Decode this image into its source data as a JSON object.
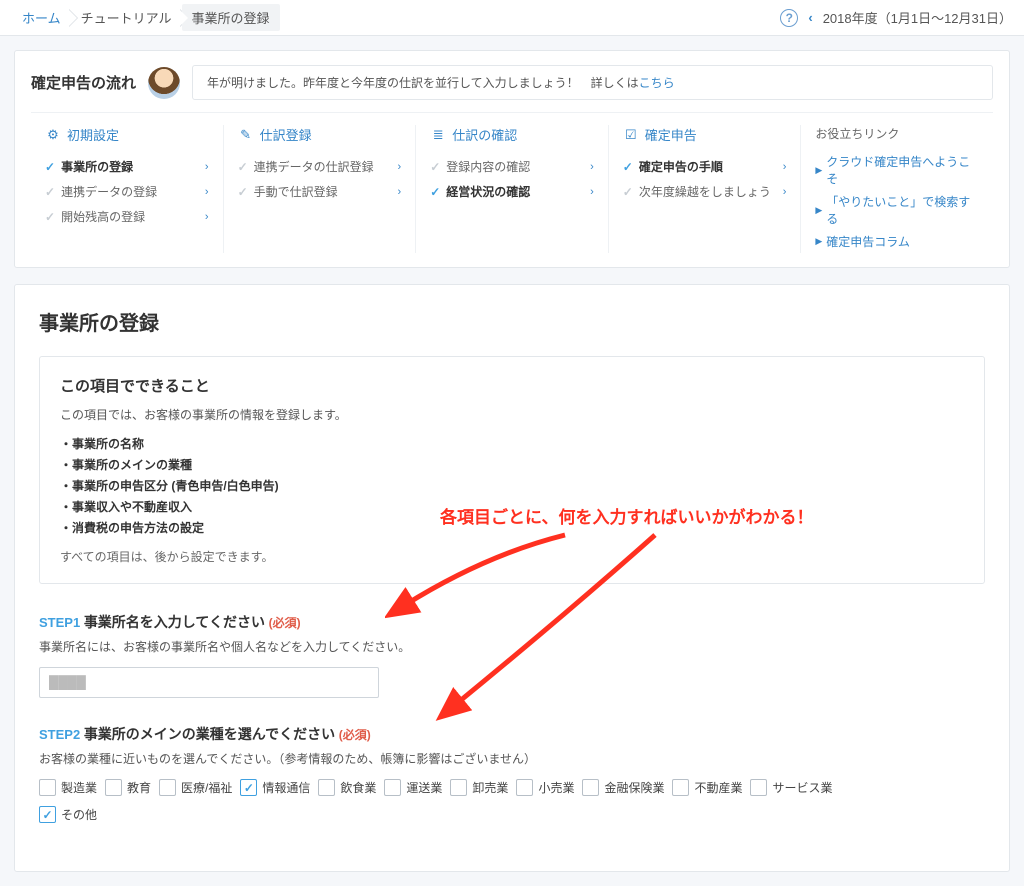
{
  "breadcrumbs": {
    "home": "ホーム",
    "tutorial": "チュートリアル",
    "current": "事業所の登録"
  },
  "period": "2018年度（1月1日〜12月31日）",
  "flow": {
    "title": "確定申告の流れ",
    "notice_pre": "年が明けました。昨年度と今年度の仕訳を並行して入力しましょう！　詳しくは",
    "notice_link": "こちら",
    "cols": [
      {
        "heading": "初期設定",
        "items": [
          {
            "label": "事業所の登録",
            "done": true,
            "bold": true
          },
          {
            "label": "連携データの登録",
            "done": false
          },
          {
            "label": "開始残高の登録",
            "done": false
          }
        ]
      },
      {
        "heading": "仕訳登録",
        "items": [
          {
            "label": "連携データの仕訳登録",
            "done": false
          },
          {
            "label": "手動で仕訳登録",
            "done": false
          }
        ]
      },
      {
        "heading": "仕訳の確認",
        "items": [
          {
            "label": "登録内容の確認",
            "done": false
          },
          {
            "label": "経営状況の確認",
            "done": true,
            "bold": true
          }
        ]
      },
      {
        "heading": "確定申告",
        "items": [
          {
            "label": "確定申告の手順",
            "done": true,
            "bold": true
          },
          {
            "label": "次年度繰越をしましょう",
            "done": false
          }
        ]
      }
    ],
    "links_heading": "お役立ちリンク",
    "links": [
      "クラウド確定申告へようこそ",
      "「やりたいこと」で検索する",
      "確定申告コラム"
    ]
  },
  "page": {
    "title": "事業所の登録",
    "info_title": "この項目でできること",
    "info_desc": "この項目では、お客様の事業所の情報を登録します。",
    "info_bullets": [
      "・事業所の名称",
      "・事業所のメインの業種",
      "・事業所の申告区分 (青色申告/白色申告)",
      "・事業収入や不動産収入",
      "・消費税の申告方法の設定"
    ],
    "info_note": "すべての項目は、後から設定できます。",
    "step1_label": "STEP1",
    "step1_title": "事業所名を入力してください",
    "required": "(必須)",
    "step1_desc": "事業所名には、お客様の事業所名や個人名などを入力してください。",
    "step2_label": "STEP2",
    "step2_title": "事業所のメインの業種を選んでください",
    "step2_desc": "お客様の業種に近いものを選んでください。（参考情報のため、帳簿に影響はございません）",
    "checks": [
      "製造業",
      "教育",
      "医療/福祉",
      "情報通信",
      "飲食業",
      "運送業",
      "卸売業",
      "小売業",
      "金融保険業",
      "不動産業",
      "サービス業"
    ],
    "checked_index": 3,
    "other_label": "その他"
  },
  "annotation": "各項目ごとに、何を入力すればいいかがわかる！"
}
